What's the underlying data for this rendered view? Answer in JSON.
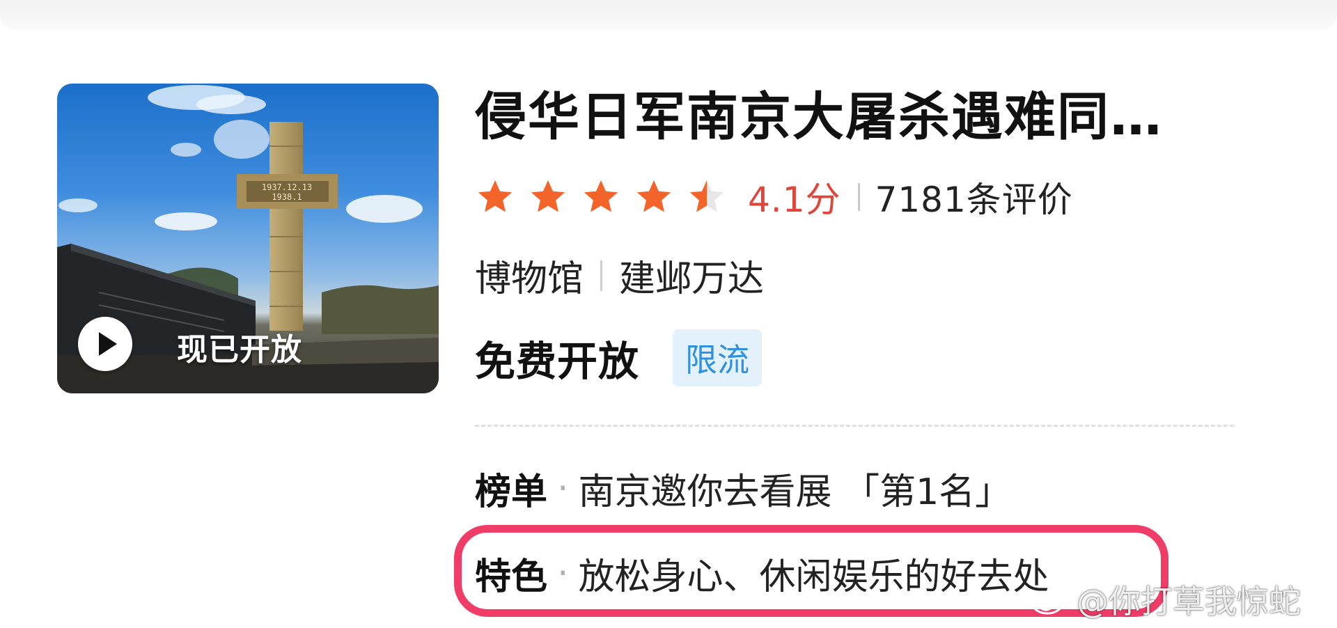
{
  "thumbnail": {
    "overlay_label": "现已开放",
    "memorial_year_start": "1937.12.13",
    "memorial_year_end": "1938.1"
  },
  "poi": {
    "title": "侵华日军南京大屠杀遇难同…",
    "rating": 4.1,
    "rating_text": "4.1分",
    "review_count_text": "7181条评价",
    "category": "博物馆",
    "area": "建邺万达",
    "admission": "免费开放",
    "admission_badge": "限流"
  },
  "ranking": {
    "label": "榜单",
    "dot": "·",
    "value": "南京邀你去看展 「第1名」"
  },
  "feature": {
    "label": "特色",
    "dot": "·",
    "value": "放松身心、休闲娱乐的好去处"
  },
  "watermark": {
    "text": "@你打草我惊蛇",
    "icon": "weibo-logo-icon"
  },
  "colors": {
    "star_fill": "#f2642a",
    "star_empty": "#e6e6e6",
    "score": "#e0453a",
    "badge_text": "#2f8fe0",
    "badge_bg": "#e3f1fd",
    "highlight": "#ef3d67"
  }
}
